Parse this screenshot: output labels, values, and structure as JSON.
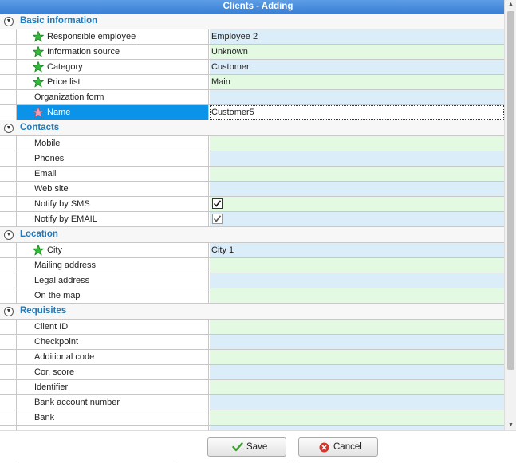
{
  "window": {
    "title": "Clients - Adding"
  },
  "sections": [
    {
      "label": "Basic information",
      "rows": [
        {
          "label": "Responsible employee",
          "value": "Employee 2",
          "required": true
        },
        {
          "label": "Information source",
          "value": "Unknown",
          "required": true
        },
        {
          "label": "Category",
          "value": "Customer",
          "required": true
        },
        {
          "label": "Price list",
          "value": "Main",
          "required": true
        },
        {
          "label": "Organization form",
          "value": ""
        },
        {
          "label": "Name",
          "value": "Customer5",
          "required": true,
          "selected": true
        }
      ]
    },
    {
      "label": "Contacts",
      "rows": [
        {
          "label": "Mobile",
          "value": ""
        },
        {
          "label": "Phones",
          "value": ""
        },
        {
          "label": "Email",
          "value": ""
        },
        {
          "label": "Web site",
          "value": ""
        },
        {
          "label": "Notify by SMS",
          "checked": true
        },
        {
          "label": "Notify by EMAIL",
          "checked": true
        }
      ]
    },
    {
      "label": "Location",
      "rows": [
        {
          "label": "City",
          "value": "City 1",
          "required": true
        },
        {
          "label": "Mailing address",
          "value": ""
        },
        {
          "label": "Legal address",
          "value": ""
        },
        {
          "label": "On the map",
          "value": ""
        }
      ]
    },
    {
      "label": "Requisites",
      "rows": [
        {
          "label": "Client ID",
          "value": ""
        },
        {
          "label": "Checkpoint",
          "value": ""
        },
        {
          "label": "Additional code",
          "value": ""
        },
        {
          "label": "Cor. score",
          "value": ""
        },
        {
          "label": "Identifier",
          "value": ""
        },
        {
          "label": "Bank account number",
          "value": ""
        },
        {
          "label": "Bank",
          "value": ""
        }
      ]
    }
  ],
  "buttons": {
    "save": "Save",
    "cancel": "Cancel"
  },
  "colors": {
    "title_bar": "#3a7fd4",
    "section_label": "#1e7bbd",
    "selected_row": "#0a93e8",
    "value_green": "#e4f9e2",
    "value_blue": "#dcedfa"
  },
  "icons": {
    "required": "green-star-icon",
    "required_selected": "red-star-icon",
    "section_toggle": "collapse-circle-icon"
  }
}
